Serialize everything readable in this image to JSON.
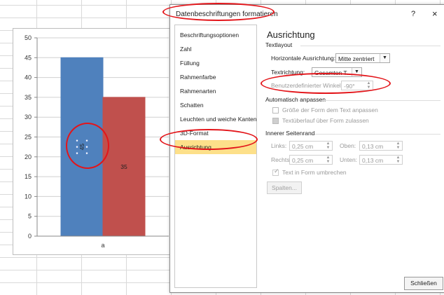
{
  "dialog": {
    "title": "Datenbeschriftungen formatieren",
    "help": "?",
    "close": "×",
    "close_button": "Schließen"
  },
  "nav": [
    "Beschriftungsoptionen",
    "Zahl",
    "Füllung",
    "Rahmenfarbe",
    "Rahmenarten",
    "Schatten",
    "Leuchten und weiche Kanten",
    "3D-Format",
    "Ausrichtung"
  ],
  "panel": {
    "heading": "Ausrichtung",
    "textlayout": "Textlayout",
    "horiz_label": "Horizontale Ausrichtung:",
    "horiz_value": "Mitte zentriert",
    "textdir_label": "Textrichtung:",
    "textdir_value": "Gesamten T...",
    "angle_label": "Benutzerdefinierter Winkel:",
    "angle_value": "-90°",
    "auto_section": "Automatisch anpassen",
    "auto_opt1": "Größe der Form dem Text anpassen",
    "auto_opt2": "Textüberlauf über Form zulassen",
    "margin_section": "Innerer Seitenrand",
    "links_label": "Links:",
    "links_value": "0,25 cm",
    "oben_label": "Oben:",
    "oben_value": "0,13 cm",
    "rechts_label": "Rechts:",
    "rechts_value": "0,25 cm",
    "unten_label": "Unten:",
    "unten_value": "0,13 cm",
    "wrap_label": "Text in Form umbrechen",
    "columns_button": "Spalten..."
  },
  "chart_data": {
    "type": "bar",
    "categories": [
      "a"
    ],
    "series": [
      {
        "values": [
          45
        ],
        "color": "#4f81bd",
        "label": "45",
        "label_rotation": -90
      },
      {
        "values": [
          35
        ],
        "color": "#c0504d",
        "label": "35"
      }
    ],
    "yticks": [
      "0",
      "5",
      "10",
      "15",
      "20",
      "25",
      "30",
      "35",
      "40",
      "45",
      "50"
    ],
    "ylim": [
      0,
      50
    ],
    "grid": true
  },
  "colors": {
    "highlight": "#fde08a",
    "annotation": "#e3151a"
  }
}
